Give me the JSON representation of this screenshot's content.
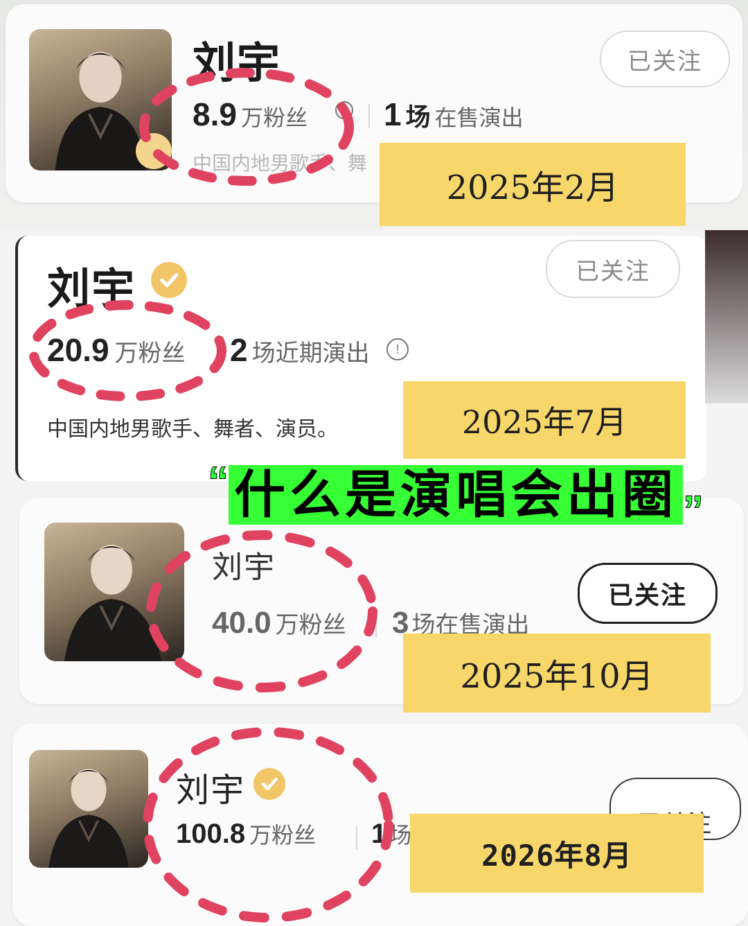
{
  "headline": {
    "open_quote": "“",
    "text": "什么是演唱会出圈",
    "close_quote": "”",
    "highlight_color": "#36ff35"
  },
  "snapshots": [
    {
      "name": "刘宇",
      "fans_count": "8.9",
      "fans_unit": "万粉丝",
      "shows_count": "1",
      "shows_unit": "场",
      "shows_text": "在售演出",
      "desc": "中国内地男歌手、舞",
      "follow_label": "已关注",
      "date_label": "2025年2月"
    },
    {
      "name": "刘宇",
      "fans_count": "20.9",
      "fans_unit": "万粉丝",
      "shows_count": "2",
      "shows_unit": "场",
      "shows_text": "近期演出",
      "info_symbol": "!",
      "desc": "中国内地男歌手、舞者、演员。",
      "follow_label": "已关注",
      "date_label": "2025年7月"
    },
    {
      "name": "刘宇",
      "fans_count": "40.0",
      "fans_unit": "万粉丝",
      "shows_count": "3",
      "shows_unit": "场",
      "shows_text": "在售演出",
      "follow_label": "已关注",
      "date_label": "2025年10月"
    },
    {
      "name": "刘宇",
      "fans_count": "100.8",
      "fans_unit": "万粉丝",
      "shows_count": "1",
      "shows_unit": "场",
      "follow_label": "已关注",
      "date_label": "2026年8月"
    }
  ],
  "colors": {
    "date_tag": "#f7d76a",
    "circle_marker": "#e0435f",
    "verified_badge": "#f2c566"
  },
  "icons": {
    "verified": "verified-check-icon",
    "info": "info-icon"
  }
}
